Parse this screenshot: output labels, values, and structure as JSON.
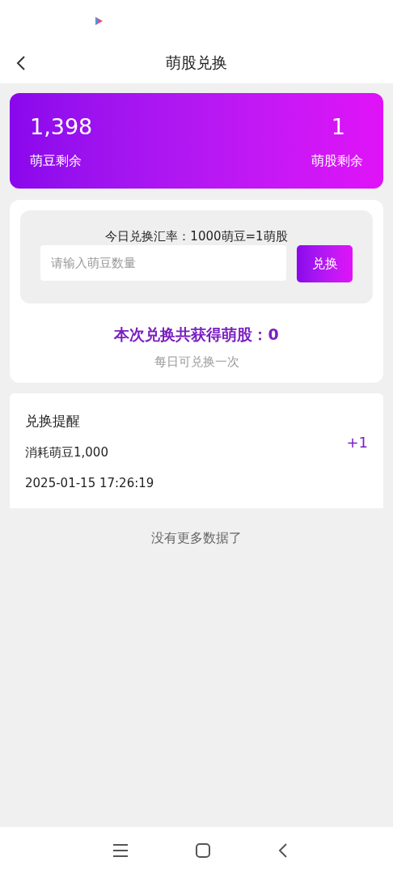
{
  "header": {
    "title": "萌股兑换"
  },
  "balance": {
    "beans": {
      "value": "1,398",
      "label": "萌豆剩余"
    },
    "shares": {
      "value": "1",
      "label": "萌股剩余"
    }
  },
  "exchange": {
    "rate": "今日兑换汇率：1000萌豆=1萌股",
    "placeholder": "请输入萌豆数量",
    "button": "兑换",
    "result": "本次兑换共获得萌股：0",
    "note": "每日可兑换一次"
  },
  "records": [
    {
      "title": "兑换提醒",
      "detail": "消耗萌豆1,000",
      "time": "2025-01-15 17:26:19",
      "amount": "+1"
    }
  ],
  "footer": "没有更多数据了"
}
